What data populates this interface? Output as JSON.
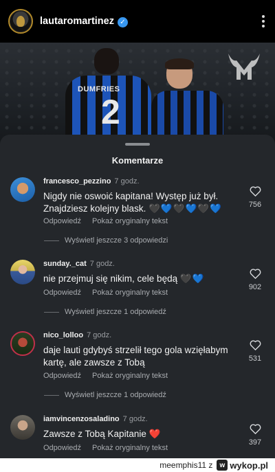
{
  "post": {
    "username": "lautaromartinez",
    "verified": true,
    "player_name": "DUMFRIES",
    "player_number": "2"
  },
  "sheet": {
    "title": "Komentarze"
  },
  "comments": [
    {
      "username": "francesco_pezzino",
      "time": "7 godz.",
      "text_line1": "Nigdy nie oswoić kapitana! Występ już był.",
      "text_line2": "Znajdziesz kolejny blask.",
      "emoji": [
        "🖤",
        "💙",
        "🖤",
        "💙",
        "🖤",
        "💙"
      ],
      "reply_label": "Odpowiedź",
      "translate_label": "Pokaż oryginalny tekst",
      "likes": "756",
      "more_replies": "Wyświetl jeszcze 3 odpowiedzi"
    },
    {
      "username": "sunday._cat",
      "time": "7 godz.",
      "text_line1": "nie przejmuj się nikim, cele będą",
      "emoji": [
        "🖤",
        "💙"
      ],
      "reply_label": "Odpowiedź",
      "translate_label": "Pokaż oryginalny tekst",
      "likes": "902",
      "more_replies": "Wyświetl jeszcze 1 odpowiedź"
    },
    {
      "username": "nico_lolloo",
      "time": "7 godz.",
      "text_line1": "daje lauti gdybyś strzelił tego gola wzięłabym",
      "text_line2": "kartę, ale zawsze z Tobą",
      "reply_label": "Odpowiedź",
      "translate_label": "Pokaż oryginalny tekst",
      "likes": "531",
      "more_replies": "Wyświetl jeszcze 1 odpowiedź"
    },
    {
      "username": "iamvincenzosaladino",
      "time": "7 godz.",
      "text_line1": "Zawsze z Tobą Kapitanie",
      "emoji": [
        "❤️"
      ],
      "reply_label": "Odpowiedź",
      "translate_label": "Pokaż oryginalny tekst",
      "likes": "397"
    }
  ],
  "watermark": {
    "user": "meemphis11",
    "separator": "z",
    "site": "wykop.pl"
  },
  "colors": {
    "sheet_bg": "#24272b",
    "verified_blue": "#3897f0",
    "heart_blue": "#2f7fe0",
    "heart_red": "#e0283c"
  },
  "icons": [
    "verified-badge-icon",
    "more-options-icon",
    "heart-outline-icon",
    "wykop-logo-icon"
  ]
}
